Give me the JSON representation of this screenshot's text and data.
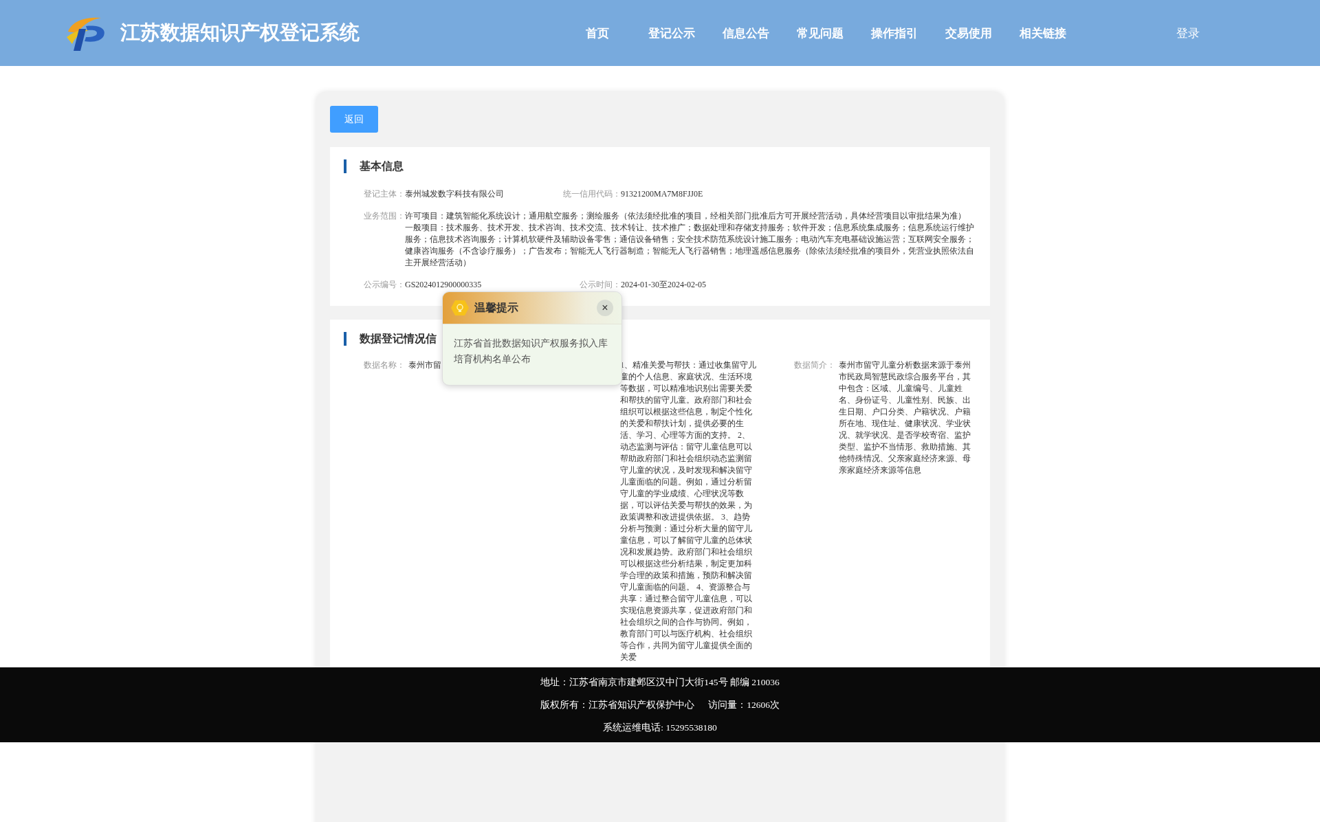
{
  "header": {
    "title": "江苏数据知识产权登记系统",
    "nav": [
      "首页",
      "登记公示",
      "信息公告",
      "常见问题",
      "操作指引",
      "交易使用",
      "相关链接"
    ],
    "login": "登录"
  },
  "back_button": "返回",
  "basic_info": {
    "title": "基本信息",
    "rows": [
      [
        {
          "label": "登记主体：",
          "value": "泰州城发数字科技有限公司"
        },
        {
          "label": "统一信用代码：",
          "value": "91321200MA7M8FJJ0E"
        }
      ],
      [
        {
          "label": "业务范围：",
          "paragraphs": [
            "许可项目：建筑智能化系统设计；通用航空服务；测绘服务（依法须经批准的项目，经相关部门批准后方可开展经营活动，具体经营项目以审批结果为准）",
            "一般项目：技术服务、技术开发、技术咨询、技术交流、技术转让、技术推广；数据处理和存储支持服务；软件开发；信息系统集成服务；信息系统运行维护服务；信息技术咨询服务；计算机软硬件及辅助设备零售；通信设备销售；安全技术防范系统设计施工服务；电动汽车充电基础设施运营；互联网安全服务；健康咨询服务（不含诊疗服务）；广告发布；智能无人飞行器制造；智能无人飞行器销售；地理遥感信息服务（除依法须经批准的项目外，凭营业执照依法自主开展经营活动）"
          ]
        }
      ],
      [
        {
          "label": "公示编号：",
          "value": "GS2024012900000335"
        },
        {
          "label": "公示时间：",
          "value": "2024-01-30至2024-02-05"
        }
      ]
    ]
  },
  "data_info": {
    "title": "数据登记情况信",
    "items": [
      {
        "label": "数据名称：",
        "value": "泰州市留"
      },
      {
        "value": "1、精准关爱与帮扶：通过收集留守儿童的个人信息、家庭状况、生活环境等数据，可以精准地识别出需要关爱和帮扶的留守儿童。政府部门和社会组织可以根据这些信息，制定个性化的关爱和帮扶计划，提供必要的生活、学习、心理等方面的支持。 2、动态监测与评估：留守儿童信息可以帮助政府部门和社会组织动态监测留守儿童的状况，及时发现和解决留守儿童面临的问题。例如，通过分析留守儿童的学业成绩、心理状况等数据，可以评估关爱与帮扶的效果，为政策调整和改进提供依据。 3、趋势分析与预测：通过分析大量的留守儿童信息，可以了解留守儿童的总体状况和发展趋势。政府部门和社会组织可以根据这些分析结果，制定更加科学合理的政策和措施，预防和解决留守儿童面临的问题。 4、资源整合与共享：通过整合留守儿童信息，可以实现信息资源共享，促进政府部门和社会组织之间的合作与协同。例如，教育部门可以与医疗机构、社会组织等合作，共同为留守儿童提供全面的关爱"
      },
      {
        "label": "数据简介：",
        "value": "泰州市留守儿童分析数据来源于泰州市民政局智慧民政综合服务平台，其中包含：区域、儿童编号、儿童姓名、身份证号、儿童性别、民族、出生日期、户口分类、户籍状况、户籍所在地、现住址、健康状况、学业状况、就学状况、是否学校寄宿、监护类型、监护不当情形、救助措施、其他特殊情况、父亲家庭经济来源、母亲家庭经济来源等信息"
      }
    ]
  },
  "notice": {
    "title": "温馨提示",
    "close": "×",
    "message": "江苏省首批数据知识产权服务拟入库培育机构名单公布"
  },
  "footer": {
    "lines": [
      [
        "地址：江苏省南京市建邺区汉中门大街145号 邮编 210036"
      ],
      [
        "版权所有：江苏省知识产权保护中心",
        "访问量：12606次"
      ],
      [
        "系统运维电话: 15295538180"
      ]
    ]
  }
}
